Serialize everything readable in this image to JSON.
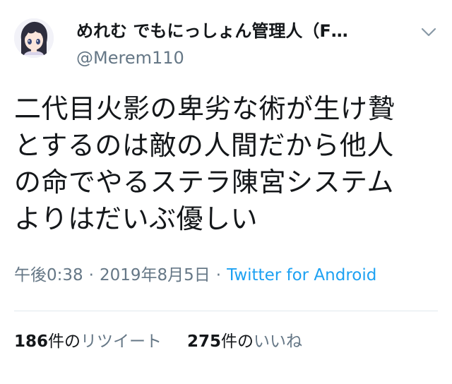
{
  "user": {
    "display_name": "めれむ でもにっしょん管理人（F…",
    "handle": "@Merem110"
  },
  "tweet": {
    "lines": [
      "二代目火影の卑劣な術が生け贄",
      "とするのは敵の人間だから他人",
      "の命でやるステラ陳宮システム",
      "よりはだいぶ優しい"
    ]
  },
  "meta": {
    "time": "午後0:38",
    "separator": "·",
    "date": "2019年8月5日",
    "source": "Twitter for Android"
  },
  "stats": {
    "retweets": {
      "count": "186",
      "unit": "件の",
      "label": "リツイート"
    },
    "likes": {
      "count": "275",
      "unit": "件の",
      "label": "いいね"
    }
  },
  "icons": {
    "menu": "chevron-down-icon",
    "avatar": "anime-character-avatar"
  },
  "colors": {
    "text": "#14171a",
    "secondary": "#657786",
    "link": "#1da1f2",
    "divider": "#e1e8ed"
  }
}
